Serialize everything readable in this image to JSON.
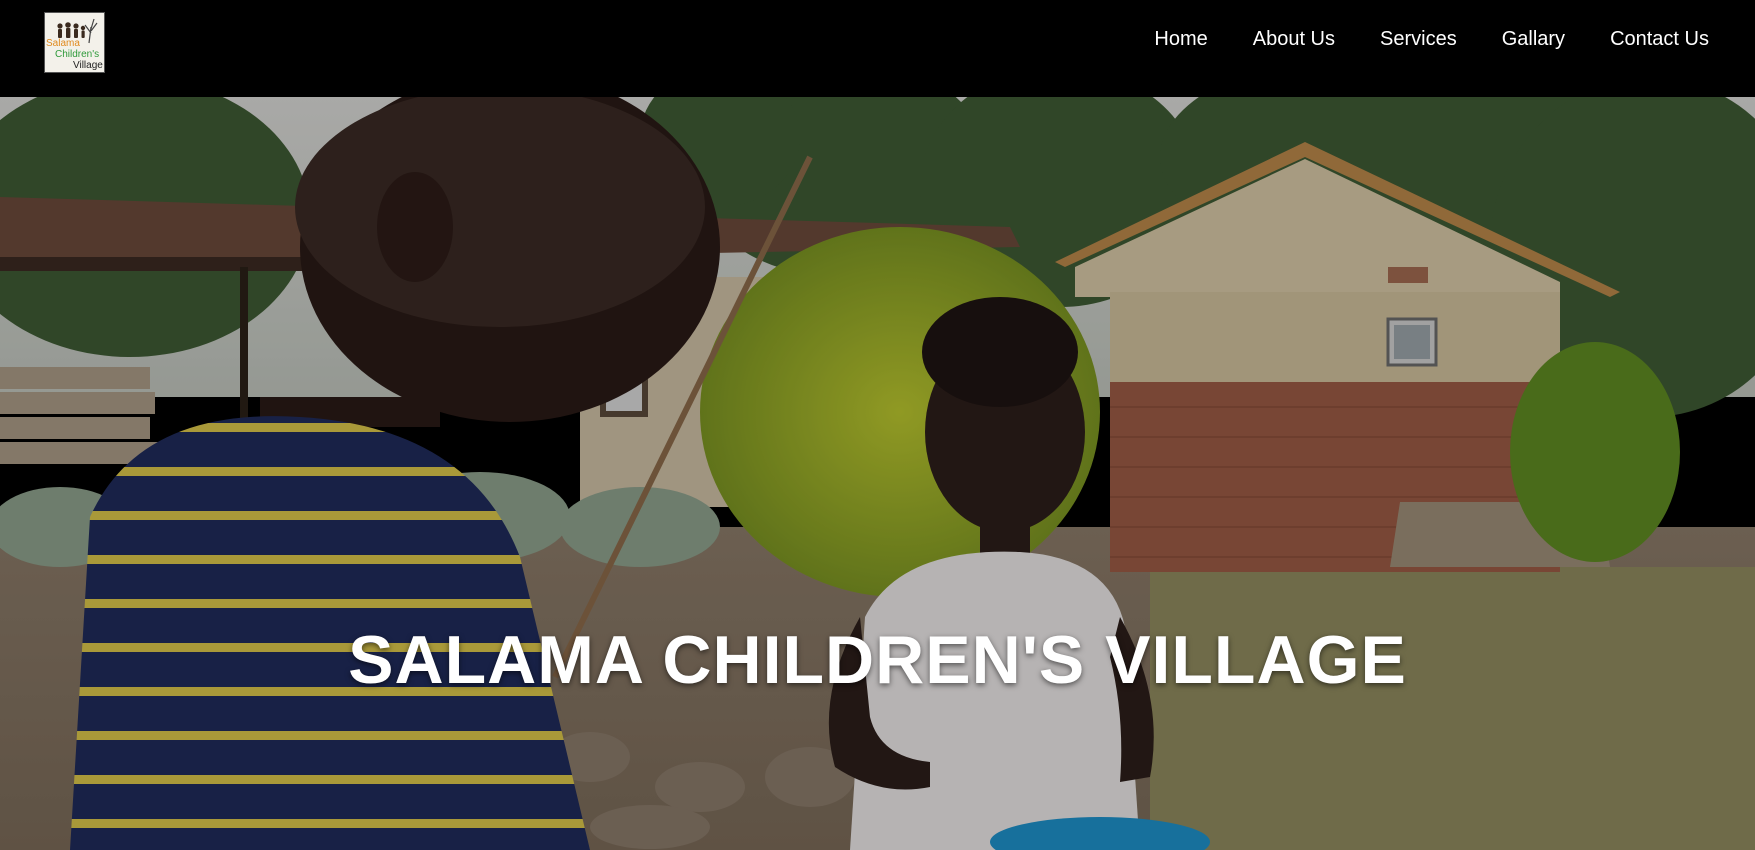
{
  "header": {
    "logo": {
      "text_line1": "Salama",
      "text_line2": "Children's",
      "text_line3": "Village",
      "icon": "family-tree-logo-icon"
    },
    "nav": [
      {
        "label": "Home"
      },
      {
        "label": "About Us"
      },
      {
        "label": "Services"
      },
      {
        "label": "Gallary"
      },
      {
        "label": "Contact Us"
      }
    ]
  },
  "hero": {
    "title": "SALAMA CHILDREN'S VILLAGE",
    "image": "children-in-village-photo"
  },
  "colors": {
    "navbar_bg": "#000000",
    "nav_text": "#ffffff",
    "hero_title": "#ffffff",
    "logo_orange": "#e08a1e",
    "logo_green": "#2e9a3a"
  }
}
